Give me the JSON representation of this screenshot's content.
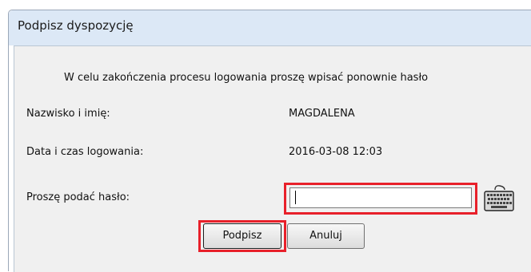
{
  "window": {
    "title": "Podpisz dyspozycję"
  },
  "dialog": {
    "instruction": "W celu zakończenia procesu logowania proszę wpisać ponownie hasło",
    "name_label": "Nazwisko i imię:",
    "name_value": "MAGDALENA",
    "date_label": "Data i czas logowania:",
    "date_value": "2016-03-08 12:03",
    "password_label": "Proszę podać hasło:",
    "password_value": ""
  },
  "buttons": {
    "sign_label": "Podpisz",
    "cancel_label": "Anuluj"
  },
  "icons": {
    "keyboard": "keyboard-icon"
  },
  "colors": {
    "highlight": "#e8202a",
    "titlebar": "#dce8f6",
    "client": "#f0f0f0"
  }
}
